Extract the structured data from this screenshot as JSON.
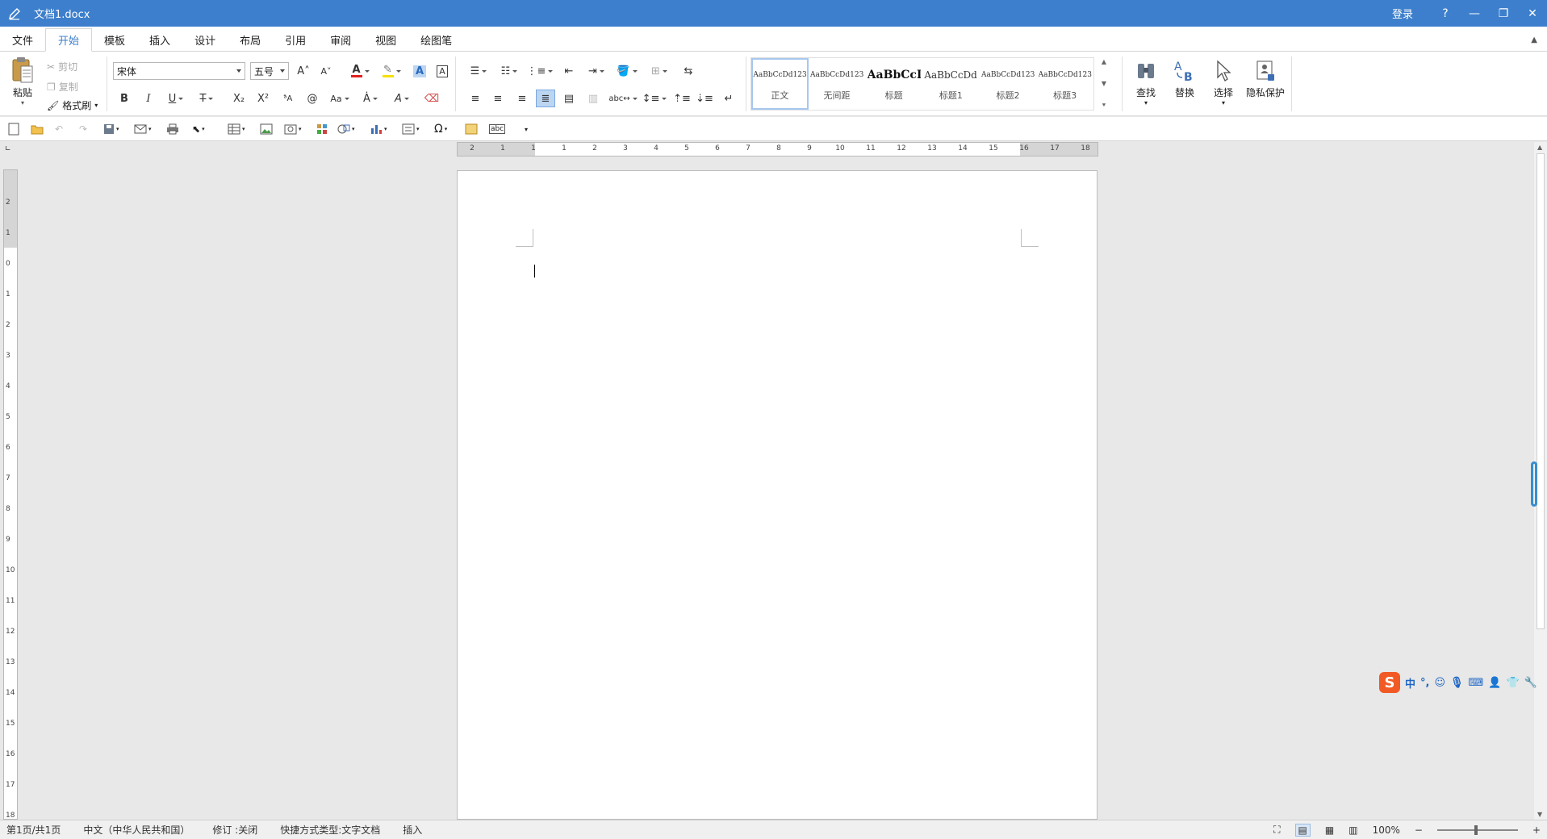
{
  "titlebar": {
    "doc_title": "文档1.docx",
    "login": "登录",
    "help": "?",
    "minimize": "—",
    "restore": "❐",
    "close": "✕"
  },
  "menu": {
    "tabs": [
      "文件",
      "开始",
      "模板",
      "插入",
      "设计",
      "布局",
      "引用",
      "审阅",
      "视图",
      "绘图笔"
    ],
    "active_index": 1
  },
  "clipboard": {
    "paste": "粘贴",
    "cut": "剪切",
    "copy": "复制",
    "format_painter": "格式刷"
  },
  "font": {
    "name": "宋体",
    "size": "五号",
    "grow": "A˄",
    "shrink": "A˅",
    "bold": "B",
    "italic": "I",
    "underline": "U",
    "strike": "T",
    "subscript": "X₂",
    "superscript": "X²",
    "font_color": "#e02020",
    "highlight_color": "#f5e000"
  },
  "styles": {
    "items": [
      {
        "preview": "AaBbCcDd123",
        "name": "正文"
      },
      {
        "preview": "AaBbCcDd123",
        "name": "无间距"
      },
      {
        "preview": "AaBbCcI",
        "name": "标题"
      },
      {
        "preview": "AaBbCcDd1",
        "name": "标题1"
      },
      {
        "preview": "AaBbCcDd123",
        "name": "标题2"
      },
      {
        "preview": "AaBbCcDd123",
        "name": "标题3"
      }
    ]
  },
  "editing": {
    "find": "查找",
    "replace": "替换",
    "select": "选择",
    "privacy": "隐私保护"
  },
  "ruler": {
    "h_numbers": [
      "2",
      "1",
      "1",
      "1",
      "2",
      "3",
      "4",
      "5",
      "6",
      "7",
      "8",
      "9",
      "10",
      "11",
      "12",
      "13",
      "14",
      "15",
      "16",
      "17",
      "18"
    ],
    "v_numbers": [
      "2",
      "1",
      "0",
      "1",
      "2",
      "3",
      "4",
      "5",
      "6",
      "7",
      "8",
      "9",
      "10",
      "11",
      "12",
      "13",
      "14",
      "15",
      "16",
      "17",
      "18"
    ]
  },
  "ime": {
    "lang": "中",
    "punct": "°,"
  },
  "status": {
    "page": "第1页/共1页",
    "language": "中文（中华人民共和国）",
    "revision": "修订 :关闭",
    "shortcut_type": "快捷方式类型:文字文档",
    "insert_mode": "插入",
    "zoom": "100%",
    "zoom_minus": "−",
    "zoom_plus": "+"
  },
  "colors": {
    "title_bar": "#3d7fcc",
    "accent": "#3d7fcc"
  }
}
